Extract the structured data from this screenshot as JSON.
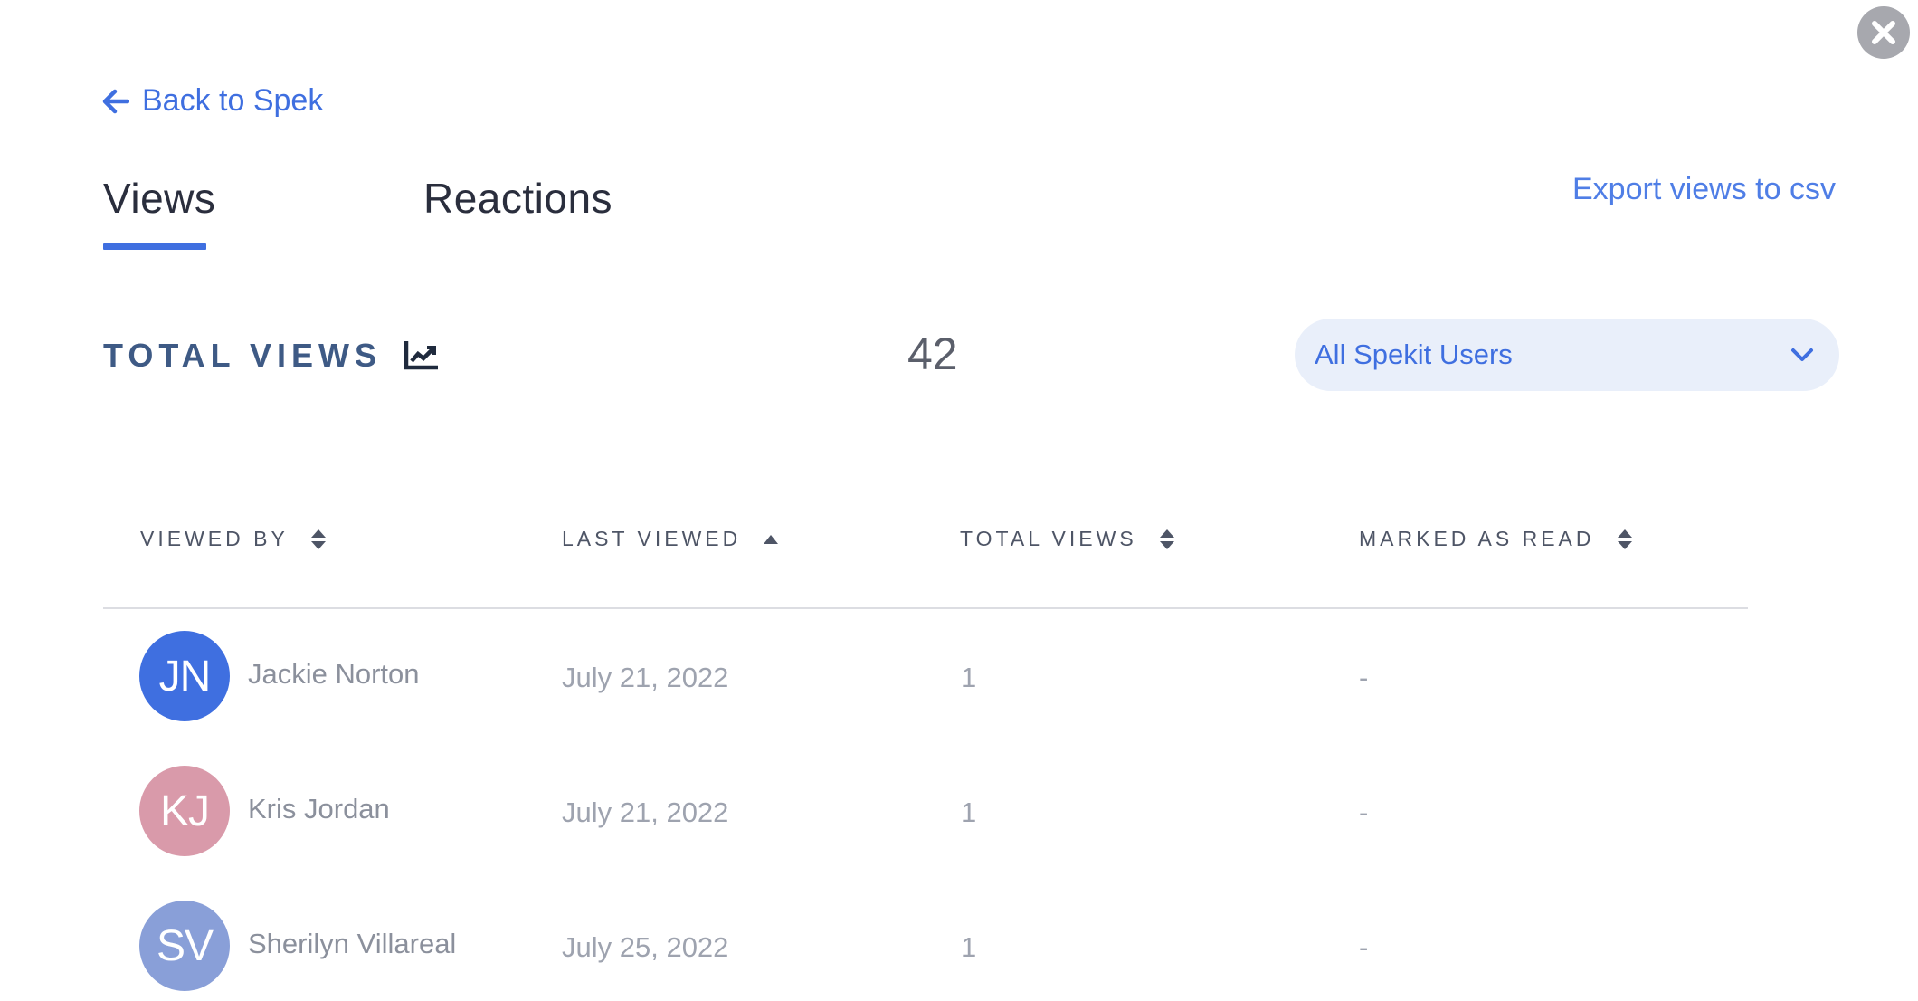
{
  "close": {
    "icon": "close-icon"
  },
  "back": {
    "label": "Back to Spek",
    "icon": "arrow-left-icon"
  },
  "tabs": [
    {
      "label": "Views",
      "active": true
    },
    {
      "label": "Reactions",
      "active": false
    }
  ],
  "export": {
    "label": "Export views to csv"
  },
  "summary": {
    "label": "TOTAL VIEWS",
    "icon": "chart-line-icon",
    "value": "42"
  },
  "filter": {
    "selected": "All Spekit Users",
    "icon": "chevron-down-icon"
  },
  "table": {
    "columns": [
      {
        "label": "VIEWED BY",
        "sort_icon": "sort-icon"
      },
      {
        "label": "LAST VIEWED",
        "sort_icon": "sort-asc-icon"
      },
      {
        "label": "TOTAL VIEWS",
        "sort_icon": "sort-icon"
      },
      {
        "label": "MARKED AS READ",
        "sort_icon": "sort-icon"
      }
    ],
    "rows": [
      {
        "initials": "JN",
        "name": "Jackie Norton",
        "avatar_color": "#3f6fe0",
        "last_viewed": "July 21, 2022",
        "total_views": "1",
        "marked_as_read": "-"
      },
      {
        "initials": "KJ",
        "name": "Kris Jordan",
        "avatar_color": "#d99aaa",
        "last_viewed": "July 21, 2022",
        "total_views": "1",
        "marked_as_read": "-"
      },
      {
        "initials": "SV",
        "name": "Sherilyn Villareal",
        "avatar_color": "#899fd8",
        "last_viewed": "July 25, 2022",
        "total_views": "1",
        "marked_as_read": "-"
      }
    ]
  },
  "colors": {
    "accent": "#3f6fe0",
    "heading": "#3e5a85",
    "select_bg": "#e9effa"
  }
}
